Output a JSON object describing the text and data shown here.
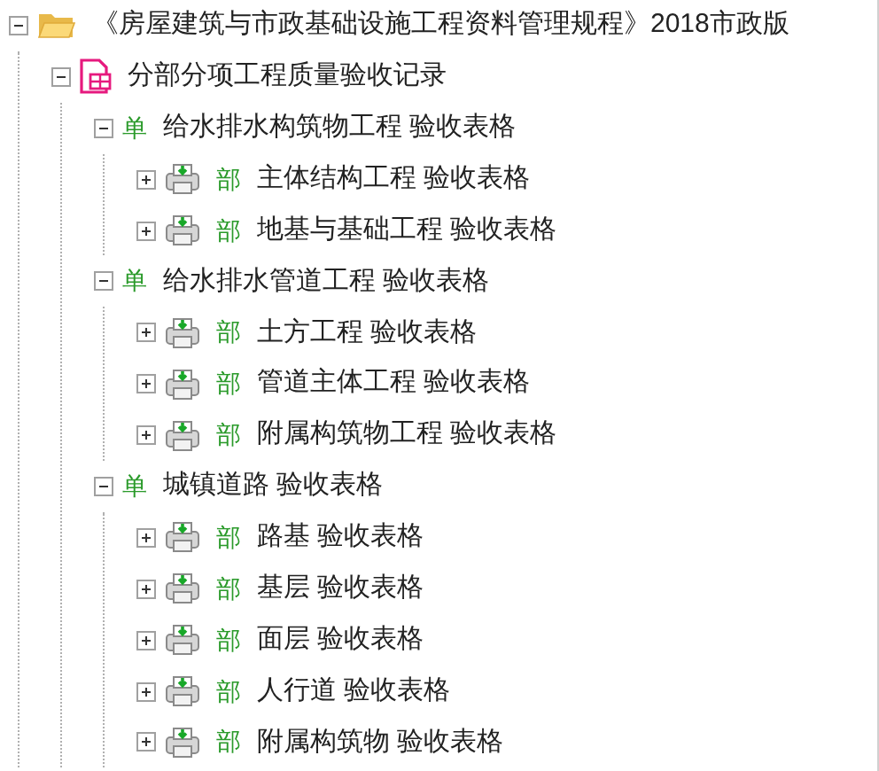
{
  "tree": {
    "kind": "folder",
    "label": "《房屋建筑与市政基础设施工程资料管理规程》2018市政版",
    "expanded": true,
    "children": [
      {
        "kind": "form",
        "label": "分部分项工程质量验收记录",
        "expanded": true,
        "children": [
          {
            "kind": "group",
            "badge": "单",
            "label": "给水排水构筑物工程 验收表格",
            "expanded": true,
            "children": [
              {
                "kind": "item",
                "badge": "部",
                "label": "主体结构工程 验收表格",
                "expanded": false
              },
              {
                "kind": "item",
                "badge": "部",
                "label": "地基与基础工程 验收表格",
                "expanded": false
              }
            ]
          },
          {
            "kind": "group",
            "badge": "单",
            "label": "给水排水管道工程 验收表格",
            "expanded": true,
            "children": [
              {
                "kind": "item",
                "badge": "部",
                "label": "土方工程 验收表格",
                "expanded": false
              },
              {
                "kind": "item",
                "badge": "部",
                "label": "管道主体工程 验收表格",
                "expanded": false
              },
              {
                "kind": "item",
                "badge": "部",
                "label": "附属构筑物工程 验收表格",
                "expanded": false
              }
            ]
          },
          {
            "kind": "group",
            "badge": "单",
            "label": "城镇道路 验收表格",
            "expanded": true,
            "children": [
              {
                "kind": "item",
                "badge": "部",
                "label": "路基 验收表格",
                "expanded": false
              },
              {
                "kind": "item",
                "badge": "部",
                "label": "基层 验收表格",
                "expanded": false
              },
              {
                "kind": "item",
                "badge": "部",
                "label": "面层 验收表格",
                "expanded": false
              },
              {
                "kind": "item",
                "badge": "部",
                "label": "人行道 验收表格",
                "expanded": false
              },
              {
                "kind": "item",
                "badge": "部",
                "label": "附属构筑物 验收表格",
                "expanded": false
              }
            ]
          }
        ]
      }
    ]
  }
}
